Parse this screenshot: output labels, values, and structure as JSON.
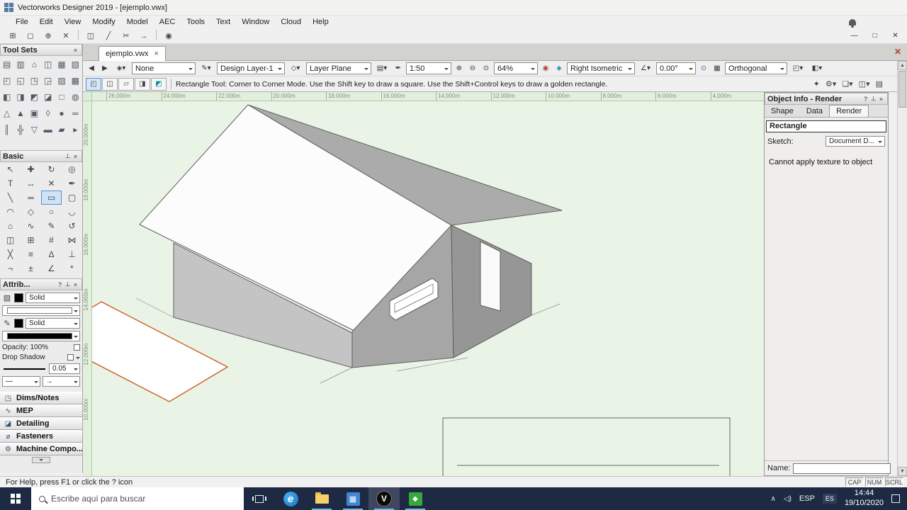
{
  "colors": {
    "canvas_bg": "#e9f4e6",
    "taskbar_bg": "#1e2a44",
    "preview_outline": "#cf5b22",
    "roof_white": "#fcfcfc",
    "wall_gray": "#a6a6a6",
    "selection_blue": "#5d8fc4"
  },
  "title_bar": {
    "title": "Vectorworks Designer 2019 - [ejemplo.vwx]"
  },
  "menu_bar": {
    "items": [
      "File",
      "Edit",
      "View",
      "Modify",
      "Model",
      "AEC",
      "Tools",
      "Text",
      "Window",
      "Cloud",
      "Help"
    ]
  },
  "toolbar": {
    "icons": [
      {
        "name": "snap-to-grid-icon",
        "glyph": "⊞"
      },
      {
        "name": "selection-marquee-icon",
        "glyph": "◻",
        "active": true
      },
      {
        "name": "snap-to-object-icon",
        "glyph": "⊕"
      },
      {
        "name": "snap-to-intersection-icon",
        "glyph": "✕"
      },
      {
        "name": "separator",
        "glyph": ""
      },
      {
        "name": "mirror-icon",
        "glyph": "◫"
      },
      {
        "name": "line-snap-icon",
        "glyph": "╱"
      },
      {
        "name": "scissors-icon",
        "glyph": "✂"
      },
      {
        "name": "move-arrow-icon",
        "glyph": "→"
      },
      {
        "name": "separator",
        "glyph": ""
      },
      {
        "name": "magnet-snap-icon",
        "glyph": "◉"
      }
    ],
    "window_controls": {
      "minimize": "—",
      "restore": "□",
      "close": "✕"
    }
  },
  "document_tab": {
    "label": "ejemplo.vwx",
    "close_glyph": "×",
    "pane_close_glyph": "✕"
  },
  "view_bar": {
    "class_value": "None",
    "layer_value": "Design Layer-1",
    "plane_value": "Layer Plane",
    "scale_value": "1:50",
    "zoom_value": "64%",
    "view_value": "Right Isometric",
    "angle_value": "0.00°",
    "projection_value": "Orthogonal",
    "icons": {
      "back": "◀",
      "forward": "▶",
      "class_menu": "◈▾",
      "layer_menu": "✎▾",
      "plane_menu": "◇▾",
      "sheet_menu": "▤▾",
      "scale_pen": "✒",
      "zoom_in": "⊕",
      "zoom_out": "⊖",
      "zoom_marquee": "⊙",
      "magnet": "◉",
      "plane_lock": "◈",
      "angle_menu": "∠▾",
      "origin": "⊙",
      "grid": "▦",
      "cube_left": "◰▾",
      "cube_right": "◧▾"
    }
  },
  "mode_bar": {
    "hint": "Rectangle Tool: Corner to Corner Mode. Use the Shift key to draw a square. Use the Shift+Control keys to draw a golden rectangle.",
    "modes": [
      {
        "name": "corner-to-corner-mode-icon",
        "glyph": "◰",
        "active": true
      },
      {
        "name": "center-to-corner-mode-icon",
        "glyph": "◫"
      },
      {
        "name": "rotated-rectangle-mode-icon",
        "glyph": "▱"
      },
      {
        "name": "corner-options-mode-icon",
        "glyph": "◨"
      },
      {
        "name": "push-pull-mode-icon",
        "glyph": "◩"
      }
    ],
    "visualization": [
      {
        "name": "flyover-tool-icon",
        "glyph": "✦"
      },
      {
        "name": "render-settings-icon",
        "glyph": "⚙▾"
      },
      {
        "name": "render-style-icon",
        "glyph": "❏▾"
      },
      {
        "name": "clip-cube-icon",
        "glyph": "◫▾"
      },
      {
        "name": "multiple-views-icon",
        "glyph": "▤"
      }
    ]
  },
  "palette_glyphs": {
    "close": "×",
    "pin": "⊥",
    "help": "?"
  },
  "tool_sets": {
    "title": "Tool Sets",
    "icons": [
      {
        "name": "wall-tool-icon",
        "glyph": "▤"
      },
      {
        "name": "round-wall-tool-icon",
        "glyph": "▥"
      },
      {
        "name": "door-tool-icon",
        "glyph": "⌂"
      },
      {
        "name": "window-tool-icon",
        "glyph": "◫"
      },
      {
        "name": "curtain-wall-tool-icon",
        "glyph": "▦"
      },
      {
        "name": "slab-tool-icon",
        "glyph": "▧"
      },
      {
        "name": "roof-face-tool-icon",
        "glyph": "◰"
      },
      {
        "name": "roof-tool-icon",
        "glyph": "◱"
      },
      {
        "name": "floor-tool-icon",
        "glyph": "◳"
      },
      {
        "name": "column-tool-icon",
        "glyph": "◲"
      },
      {
        "name": "pilaster-tool-icon",
        "glyph": "▨"
      },
      {
        "name": "stair-tool-icon",
        "glyph": "▩"
      },
      {
        "name": "ramp-tool-icon",
        "glyph": "◧"
      },
      {
        "name": "space-tool-icon",
        "glyph": "◨"
      },
      {
        "name": "beam-tool-icon",
        "glyph": "◩"
      },
      {
        "name": "truss-tool-icon",
        "glyph": "◪"
      },
      {
        "name": "framing-member-tool-icon",
        "glyph": "□"
      },
      {
        "name": "joist-tool-icon",
        "glyph": "◍"
      },
      {
        "name": "grid-line-tool-icon",
        "glyph": "△"
      },
      {
        "name": "massing-model-tool-icon",
        "glyph": "▲"
      },
      {
        "name": "site-model-tool-icon",
        "glyph": "▣"
      },
      {
        "name": "plant-tool-icon",
        "glyph": "◊"
      },
      {
        "name": "hardscape-tool-icon",
        "glyph": "●"
      },
      {
        "name": "fence-tool-icon",
        "glyph": "═"
      },
      {
        "name": "detail-callout-tool-icon",
        "glyph": "║"
      },
      {
        "name": "section-line-tool-icon",
        "glyph": "╬"
      },
      {
        "name": "elevation-tool-icon",
        "glyph": "▽"
      },
      {
        "name": "drawing-label-tool-icon",
        "glyph": "▬"
      },
      {
        "name": "keynote-tool-icon",
        "glyph": "▰"
      },
      {
        "name": "north-arrow-tool-icon",
        "glyph": "▸"
      }
    ]
  },
  "basic_palette": {
    "title": "Basic",
    "tools": [
      {
        "name": "selection-tool-icon",
        "glyph": "↖"
      },
      {
        "name": "pan-tool-icon",
        "glyph": "✚"
      },
      {
        "name": "rotate-view-tool-icon",
        "glyph": "↻"
      },
      {
        "name": "zoom-tool-icon",
        "glyph": "◎"
      },
      {
        "name": "text-tool-icon",
        "glyph": "T"
      },
      {
        "name": "dimension-tool-icon",
        "glyph": "↔"
      },
      {
        "name": "trim-tool-icon",
        "glyph": "✕"
      },
      {
        "name": "eyedropper-tool-icon",
        "glyph": "✒"
      },
      {
        "name": "line-tool-icon",
        "glyph": "╲"
      },
      {
        "name": "double-line-tool-icon",
        "glyph": "═"
      },
      {
        "name": "rectangle-tool-icon",
        "glyph": "▭",
        "active": true
      },
      {
        "name": "rounded-rectangle-tool-icon",
        "glyph": "▢"
      },
      {
        "name": "arc-tool-icon",
        "glyph": "◠"
      },
      {
        "name": "polygon-tool-icon",
        "glyph": "◇"
      },
      {
        "name": "circle-tool-icon",
        "glyph": "○"
      },
      {
        "name": "ellipse-tool-icon",
        "glyph": "◡"
      },
      {
        "name": "regular-polygon-tool-icon",
        "glyph": "⌂"
      },
      {
        "name": "polyline-tool-icon",
        "glyph": "∿"
      },
      {
        "name": "freehand-tool-icon",
        "glyph": "✎"
      },
      {
        "name": "spiral-tool-icon",
        "glyph": "↺"
      },
      {
        "name": "mirror-tool-icon",
        "glyph": "◫"
      },
      {
        "name": "symbol-insert-tool-icon",
        "glyph": "⊞"
      },
      {
        "name": "hatch-tool-icon",
        "glyph": "#"
      },
      {
        "name": "connect-tool-icon",
        "glyph": "⋈"
      },
      {
        "name": "break-tool-icon",
        "glyph": "╳"
      },
      {
        "name": "offset-tool-icon",
        "glyph": "≡"
      },
      {
        "name": "fillet-tool-icon",
        "glyph": "∆"
      },
      {
        "name": "chamfer-tool-icon",
        "glyph": "⊥"
      },
      {
        "name": "clip-tool-icon",
        "glyph": "¬"
      },
      {
        "name": "move-by-points-tool-icon",
        "glyph": "±"
      },
      {
        "name": "protractor-tool-icon",
        "glyph": "∠"
      },
      {
        "name": "locus-tool-icon",
        "glyph": "*"
      }
    ]
  },
  "attributes": {
    "title": "Attrib...",
    "fill_icon": "▨",
    "pen_icon": "✎",
    "fill_style": "Solid",
    "pen_style": "Solid",
    "opacity_label": "Opacity: 100%",
    "drop_shadow_label": "Drop Shadow",
    "line_weight": "0.05",
    "marker_left": "—",
    "marker_right": "→"
  },
  "tool_set_groups": [
    {
      "name": "toolset-group-dims-notes",
      "glyph": "◳",
      "label": "Dims/Notes"
    },
    {
      "name": "toolset-group-mep",
      "glyph": "∿",
      "label": "MEP"
    },
    {
      "name": "toolset-group-detailing",
      "glyph": "◪",
      "label": "Detailing"
    },
    {
      "name": "toolset-group-fasteners",
      "glyph": "⌀",
      "label": "Fasteners"
    },
    {
      "name": "toolset-group-machine-components",
      "glyph": "⚙",
      "label": "Machine Compo..."
    }
  ],
  "rulers": {
    "horizontal": [
      "26.000m",
      "24.000m",
      "22.000m",
      "20.000m",
      "18.000m",
      "16.000m",
      "14.000m",
      "12.000m",
      "10.000m",
      "8.000m",
      "6.000m",
      "4.000m"
    ],
    "vertical": [
      "20.000m",
      "18.000m",
      "16.000m",
      "14.000m",
      "12.000m",
      "10.000m"
    ]
  },
  "object_info": {
    "title": "Object Info - Render",
    "tabs": [
      {
        "label": "Shape"
      },
      {
        "label": "Data"
      },
      {
        "label": "Render",
        "active": true
      }
    ],
    "more_glyph": "▸",
    "type": "Rectangle",
    "sketch_label": "Sketch:",
    "sketch_value": "Document D...",
    "message": "Cannot apply texture to object",
    "name_label": "Name:",
    "name_value": ""
  },
  "status_bar": {
    "text": "For Help, press F1 or click the ? icon",
    "indicators": [
      "CAP",
      "NUM",
      "SCRL"
    ]
  },
  "taskbar": {
    "search_placeholder": "Escribe aquí para buscar",
    "edge_letter": "e",
    "blue_app_glyph": "▦",
    "vectorworks_letter": "V",
    "green_app_glyph": "◆",
    "tray_expand_glyph": "∧",
    "volume_glyph": "◁)",
    "language": "ESP",
    "keyboard": "ES",
    "time": "14:44",
    "date": "19/10/2020"
  }
}
